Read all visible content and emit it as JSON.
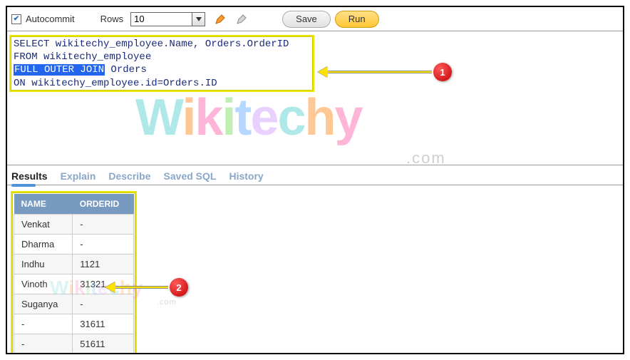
{
  "toolbar": {
    "autocommit_label": "Autocommit",
    "autocommit_checked": true,
    "rows_label": "Rows",
    "rows_value": "10",
    "save_label": "Save",
    "run_label": "Run"
  },
  "sql": {
    "line1_a": "SELECT wikitechy_employee.Name, Orders.OrderID",
    "line2_a": "FROM wikitechy_employee",
    "line3_highlight": "FULL OUTER JOIN",
    "line3_b": " Orders",
    "line4_a": "ON wikitechy_employee.id=Orders.ID"
  },
  "tabs": {
    "results": "Results",
    "explain": "Explain",
    "describe": "Describe",
    "saved_sql": "Saved SQL",
    "history": "History"
  },
  "table": {
    "headers": {
      "name": "NAME",
      "orderid": "ORDERID"
    },
    "rows": [
      {
        "name": "Venkat",
        "orderid": "-"
      },
      {
        "name": "Dharma",
        "orderid": "-"
      },
      {
        "name": "Indhu",
        "orderid": "1121"
      },
      {
        "name": "Vinoth",
        "orderid": "31321"
      },
      {
        "name": "Suganya",
        "orderid": "-"
      },
      {
        "name": "-",
        "orderid": "31611"
      },
      {
        "name": "-",
        "orderid": "51611"
      }
    ]
  },
  "callouts": {
    "one": "1",
    "two": "2"
  },
  "watermark": {
    "text": "Wikitechy",
    "suffix": ".com"
  }
}
